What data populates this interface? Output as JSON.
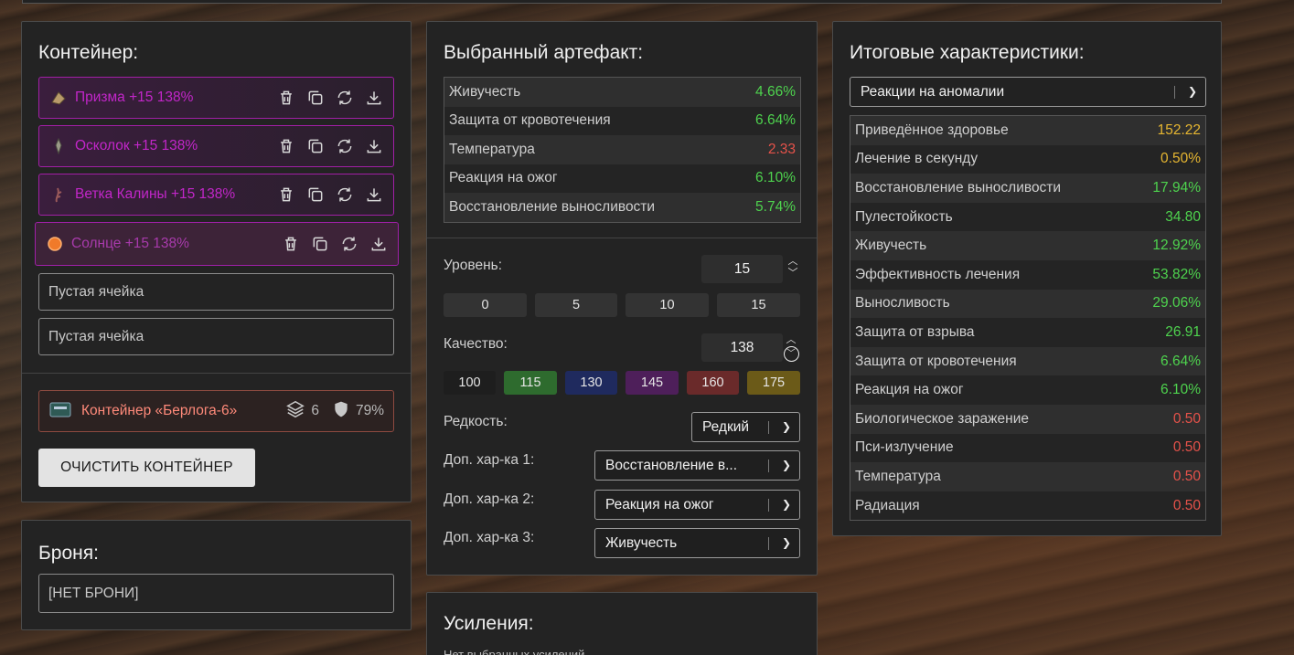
{
  "container": {
    "title": "Контейнер:",
    "slots": [
      {
        "label": "Призма +15 138%",
        "icon": "prism-artifact-icon"
      },
      {
        "label": "Осколок +15 138%",
        "icon": "shard-artifact-icon"
      },
      {
        "label": "Ветка Калины +15 138%",
        "icon": "branch-artifact-icon"
      },
      {
        "label": "Солнце +15 138%",
        "icon": "sun-artifact-icon"
      }
    ],
    "empty_slots": [
      "Пустая ячейка",
      "Пустая ячейка"
    ],
    "box": {
      "label": "Контейнер «Берлога-6»",
      "capacity": "6",
      "protection": "79%"
    },
    "clear_button": "ОЧИСТИТЬ КОНТЕЙНЕР"
  },
  "armor": {
    "title": "Броня:",
    "value": "[НЕТ БРОНИ]"
  },
  "artifact": {
    "title": "Выбранный артефакт:",
    "stats": [
      {
        "name": "Живучесть",
        "value": "4.66%",
        "tone": "good"
      },
      {
        "name": "Защита от кровотечения",
        "value": "6.64%",
        "tone": "good"
      },
      {
        "name": "Температура",
        "value": "2.33",
        "tone": "bad"
      },
      {
        "name": "Реакция на ожог",
        "value": "6.10%",
        "tone": "good"
      },
      {
        "name": "Восстановление выносливости",
        "value": "5.74%",
        "tone": "good"
      }
    ],
    "level_label": "Уровень:",
    "level_value": "15",
    "level_presets": [
      "0",
      "5",
      "10",
      "15"
    ],
    "quality_label": "Качество:",
    "quality_value": "138",
    "quality_presets": [
      {
        "label": "100",
        "color": "#1e1e1e"
      },
      {
        "label": "115",
        "color": "#2e6b2e"
      },
      {
        "label": "130",
        "color": "#1f2a5e"
      },
      {
        "label": "145",
        "color": "#4e1f5a"
      },
      {
        "label": "160",
        "color": "#6a2a2a"
      },
      {
        "label": "175",
        "color": "#6b5a18"
      }
    ],
    "rarity_label": "Редкость:",
    "rarity_value": "Редкий",
    "extra1_label": "Доп. хар-ка 1:",
    "extra1_value": "Восстановление в...",
    "extra2_label": "Доп. хар-ка 2:",
    "extra2_value": "Реакция на ожог",
    "extra3_label": "Доп. хар-ка 3:",
    "extra3_value": "Живучесть"
  },
  "boosts": {
    "title": "Усиления:",
    "empty": "Нет выбранных усилений"
  },
  "totals": {
    "title": "Итоговые характеристики:",
    "filter_value": "Реакции на аномалии",
    "stats": [
      {
        "name": "Приведённое здоровье",
        "value": "152.22",
        "tone": "warn"
      },
      {
        "name": "Лечение в секунду",
        "value": "0.50%",
        "tone": "warn"
      },
      {
        "name": "Восстановление выносливости",
        "value": "17.94%",
        "tone": "good"
      },
      {
        "name": "Пулестойкость",
        "value": "34.80",
        "tone": "good"
      },
      {
        "name": "Живучесть",
        "value": "12.92%",
        "tone": "good"
      },
      {
        "name": "Эффективность лечения",
        "value": "53.82%",
        "tone": "good"
      },
      {
        "name": "Выносливость",
        "value": "29.06%",
        "tone": "good"
      },
      {
        "name": "Защита от взрыва",
        "value": "26.91",
        "tone": "good"
      },
      {
        "name": "Защита от кровотечения",
        "value": "6.64%",
        "tone": "good"
      },
      {
        "name": "Реакция на ожог",
        "value": "6.10%",
        "tone": "good"
      },
      {
        "name": "Биологическое заражение",
        "value": "0.50",
        "tone": "bad"
      },
      {
        "name": "Пси-излучение",
        "value": "0.50",
        "tone": "bad"
      },
      {
        "name": "Температура",
        "value": "0.50",
        "tone": "bad"
      },
      {
        "name": "Радиация",
        "value": "0.50",
        "tone": "bad"
      }
    ]
  }
}
